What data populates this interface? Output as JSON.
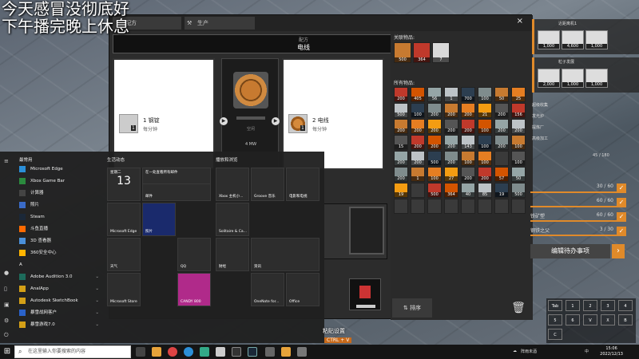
{
  "overlay": {
    "line1": "今天感冒没彻底好",
    "line2": "下午播完晚上休息"
  },
  "window": {
    "tabs": [
      {
        "label": "配方"
      },
      {
        "label": "生产"
      }
    ],
    "close": "×"
  },
  "recipe": {
    "header_small": "配方",
    "header_title": "电线"
  },
  "input": {
    "name": "1 钢锭",
    "count": "1",
    "rate": "每分钟"
  },
  "output": {
    "name": "2 电线",
    "count": "1",
    "rate": "每分钟"
  },
  "machine": {
    "status": "空闲",
    "power": "4 MW"
  },
  "inventory": {
    "related_label": "关联物品:",
    "related": [
      {
        "count": "500",
        "color": "#c77a30"
      },
      {
        "count": "364",
        "color": "#c0392b"
      },
      {
        "count": "7",
        "color": "#d9d9d9"
      }
    ],
    "all_label": "所有物品:",
    "rows": [
      [
        "200",
        "405",
        "56",
        "1",
        "700",
        "100",
        "50",
        "25"
      ],
      [
        "500",
        "100",
        "200",
        "200",
        "200",
        "21",
        "200",
        "156"
      ],
      [
        "200",
        "200",
        "200",
        "200",
        "200",
        "100",
        "200",
        "200"
      ],
      [
        "15",
        "200",
        "200",
        "200",
        "143",
        "100",
        "200",
        "100"
      ],
      [
        "200",
        "200",
        "500",
        "200",
        "100",
        "100",
        "",
        "100"
      ],
      [
        "200",
        "1",
        "100",
        "27",
        "200",
        "200",
        "57",
        "50"
      ],
      [
        "19",
        "",
        "500",
        "364",
        "40",
        "85",
        "19",
        "500"
      ],
      [
        "",
        "",
        "",
        "",
        "",
        "",
        "",
        ""
      ]
    ],
    "sort_label": "排序"
  },
  "hud": {
    "panel1_title": "近距离机1",
    "panel2_title": "粒子发展",
    "tiles1": [
      "1,000",
      "4,600",
      "1,000"
    ],
    "tiles2": [
      "2,000",
      "1,000",
      "1,000"
    ],
    "tasks": [
      {
        "label": "30 / 60"
      },
      {
        "label": "60 / 60"
      },
      {
        "label": "60 / 60"
      },
      {
        "label": "60 / 60"
      },
      {
        "label": "3 / 30"
      }
    ],
    "side_labels": [
      "超级收集",
      "45 / 180",
      "发光炉",
      "提炼厂",
      "高级加工",
      "铁矿塑",
      "钢铁之父"
    ],
    "edit_label": "编辑待办事项",
    "hotkeys": [
      "Tab",
      "1",
      "2",
      "3",
      "4",
      "5",
      "6",
      "V",
      "X",
      "B",
      "C"
    ]
  },
  "startmenu": {
    "sections": {
      "recent": "最常用",
      "create": "生活动态",
      "play": "播放和浏览"
    },
    "apps": [
      {
        "label": "Microsoft Edge",
        "color": "#2b8fd8"
      },
      {
        "label": "Xbox Game Bar",
        "color": "#2b8a3e"
      },
      {
        "label": "计算器",
        "color": "#444"
      },
      {
        "label": "照片",
        "color": "#3a6bc8"
      },
      {
        "label": "Steam",
        "color": "#1b2838"
      },
      {
        "label": "斗鱼直播",
        "color": "#ff6a00"
      },
      {
        "label": "3D 查看器",
        "color": "#4a90d9"
      },
      {
        "label": "360安全中心",
        "color": "#ffb400"
      },
      {
        "label": "A",
        "color": ""
      },
      {
        "label": "Adobe Audition 3.0",
        "color": "#1d6b5b"
      },
      {
        "label": "AnalApp",
        "color": "#d4a017"
      },
      {
        "label": "Autodesk SketchBook",
        "color": "#d4a017"
      },
      {
        "label": "暴雪战网客户",
        "color": "#2a62c9"
      },
      {
        "label": "暴雪游戏7.0",
        "color": "#d4a017"
      }
    ],
    "tiles": [
      {
        "label": "星期二",
        "big": "13"
      },
      {
        "label": "在一处查看所有邮件"
      },
      {
        "label": "邮件"
      },
      {
        "label": "Xbox 主机小..."
      },
      {
        "label": "Groove 音乐"
      },
      {
        "label": "电影和电视"
      },
      {
        "label": "Microsoft Edge"
      },
      {
        "label": "照片"
      },
      {
        "label": "Solitaire & Ca..."
      },
      {
        "label": "天气"
      },
      {
        "label": "QQ"
      },
      {
        "label": "财经"
      },
      {
        "label": "资讯"
      },
      {
        "label": "Microsoft Store"
      },
      {
        "label": "CANDY 800"
      },
      {
        "label": "OneNote for..."
      },
      {
        "label": "Office"
      }
    ]
  },
  "taskbar": {
    "search_placeholder": "在这里输入你要搜索的内容",
    "tray_weather": "阵雨未酒",
    "clock_time": "15:06",
    "clock_date": "2022/12/13",
    "lang": "中"
  },
  "hint": {
    "text": "粘贴设置",
    "key": "CTRL + V"
  }
}
